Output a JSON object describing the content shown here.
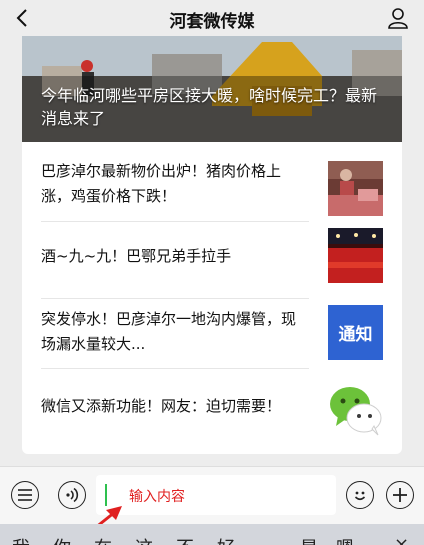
{
  "header": {
    "title": "河套微传媒",
    "back_icon": "chevron-left-icon",
    "profile_icon": "person-icon"
  },
  "hero": {
    "title": "今年临河哪些平房区接大暖，啥时候完工？最新消息来了"
  },
  "news": [
    {
      "title": "巴彦淖尔最新物价出炉！猪肉价格上涨，鸡蛋价格下跌！",
      "thumb": "market-photo"
    },
    {
      "title": "酒~九~九！巴鄂兄弟手拉手",
      "thumb": "red-stadium-photo"
    },
    {
      "title": "突发停水！巴彦淖尔一地沟内爆管，现场漏水量较大...",
      "thumb": "notice-image",
      "thumb_text": "通知"
    },
    {
      "title": "微信又添新功能！网友：迫切需要！",
      "thumb": "wechat-logo"
    }
  ],
  "composer": {
    "menu_icon": "list-menu-icon",
    "voice_icon": "voice-icon",
    "placeholder": "输入内容",
    "emoji_icon": "emoji-icon",
    "add_icon": "plus-icon"
  },
  "keyboard": {
    "candidates": [
      "我",
      "你",
      "在",
      "这",
      "不",
      "好",
      "是",
      "嗯",
      "×"
    ]
  },
  "colors": {
    "accent_green": "#2ec04f",
    "placeholder_red": "#e02020",
    "arrow_red": "#e02020"
  }
}
